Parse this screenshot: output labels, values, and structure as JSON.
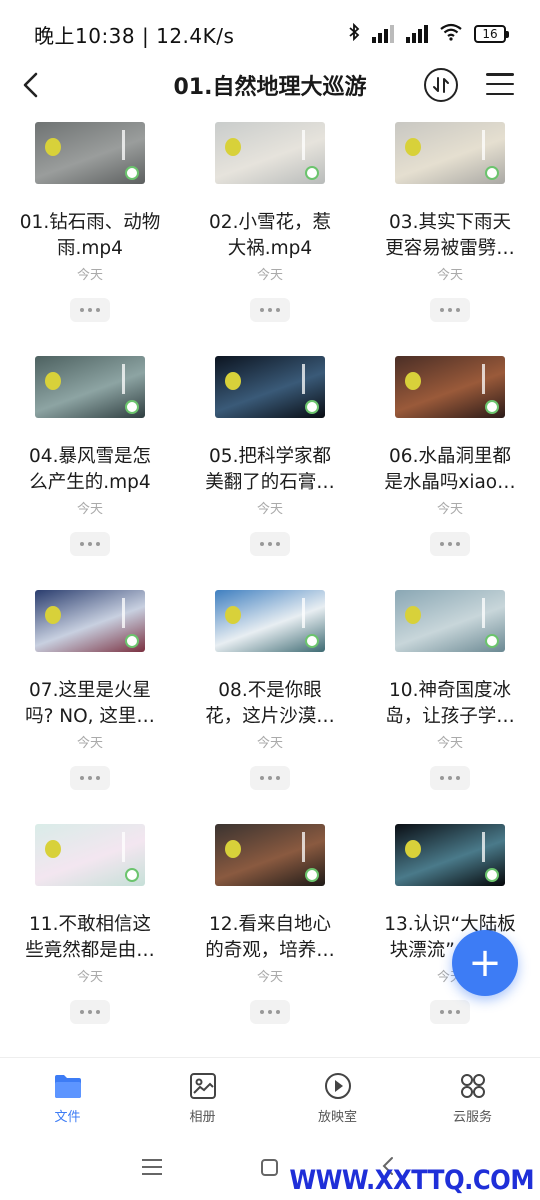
{
  "status": {
    "time_speed": "晚上10:38 | 12.4K/s",
    "battery": "16"
  },
  "header": {
    "title": "01.自然地理大巡游"
  },
  "files": [
    {
      "line1": "01.钻石雨、动物",
      "line2": "雨.mp4",
      "date": "今天",
      "colors": [
        "#6f7373",
        "#9a9d9c",
        "#5c5f5f"
      ]
    },
    {
      "line1": "02.小雪花，惹",
      "line2": "大祸.mp4",
      "date": "今天",
      "colors": [
        "#c9cccb",
        "#e6e3dc",
        "#b8bbba"
      ]
    },
    {
      "line1": "03.其实下雨天",
      "line2": "更容易被雷劈…",
      "date": "今天",
      "colors": [
        "#c8c7c2",
        "#e5dfd0",
        "#a9a8a4"
      ]
    },
    {
      "line1": "04.暴风雪是怎",
      "line2": "么产生的.mp4",
      "date": "今天",
      "colors": [
        "#4d6160",
        "#8da4a3",
        "#2e3d3f"
      ]
    },
    {
      "line1": "05.把科学家都",
      "line2": "美翻了的石膏…",
      "date": "今天",
      "colors": [
        "#0c1420",
        "#3a5a78",
        "#080c12"
      ]
    },
    {
      "line1": "06.水晶洞里都",
      "line2": "是水晶吗xiao…",
      "date": "今天",
      "colors": [
        "#4a2e26",
        "#9a5a3a",
        "#2a1a18"
      ]
    },
    {
      "line1": "07.这里是火星",
      "line2": "吗? NO, 这里…",
      "date": "今天",
      "colors": [
        "#2a3d6e",
        "#c8d0e0",
        "#7a3040"
      ]
    },
    {
      "line1": "08.不是你眼",
      "line2": "花，这片沙漠…",
      "date": "今天",
      "colors": [
        "#3f7fc0",
        "#e8eef2",
        "#3d6a72"
      ]
    },
    {
      "line1": "10.神奇国度冰",
      "line2": "岛，让孩子学…",
      "date": "今天",
      "colors": [
        "#8aa7b4",
        "#c8d6da",
        "#6a8892"
      ]
    },
    {
      "line1": "11.不敢相信这",
      "line2": "些竟然都是由…",
      "date": "今天",
      "colors": [
        "#d9ece8",
        "#f3e6f0",
        "#c6e0d8"
      ]
    },
    {
      "line1": "12.看来自地心",
      "line2": "的奇观，培养…",
      "date": "今天",
      "colors": [
        "#3a3330",
        "#8a5a40",
        "#1e1a18"
      ]
    },
    {
      "line1": "13.认识“大陆板",
      "line2": "块漂流”，思…",
      "date": "今天",
      "colors": [
        "#0a0e14",
        "#4a7a8a",
        "#040608"
      ]
    }
  ],
  "tabs": [
    {
      "label": "文件",
      "icon": "folder-icon"
    },
    {
      "label": "相册",
      "icon": "album-icon"
    },
    {
      "label": "放映室",
      "icon": "play-icon"
    },
    {
      "label": "云服务",
      "icon": "grid-icon"
    }
  ],
  "watermark": "WWW.XXTTQ.COM",
  "fab_symbol": "+",
  "colors": {
    "accent": "#3d7cf5",
    "watermark": "#1f2fd8"
  }
}
